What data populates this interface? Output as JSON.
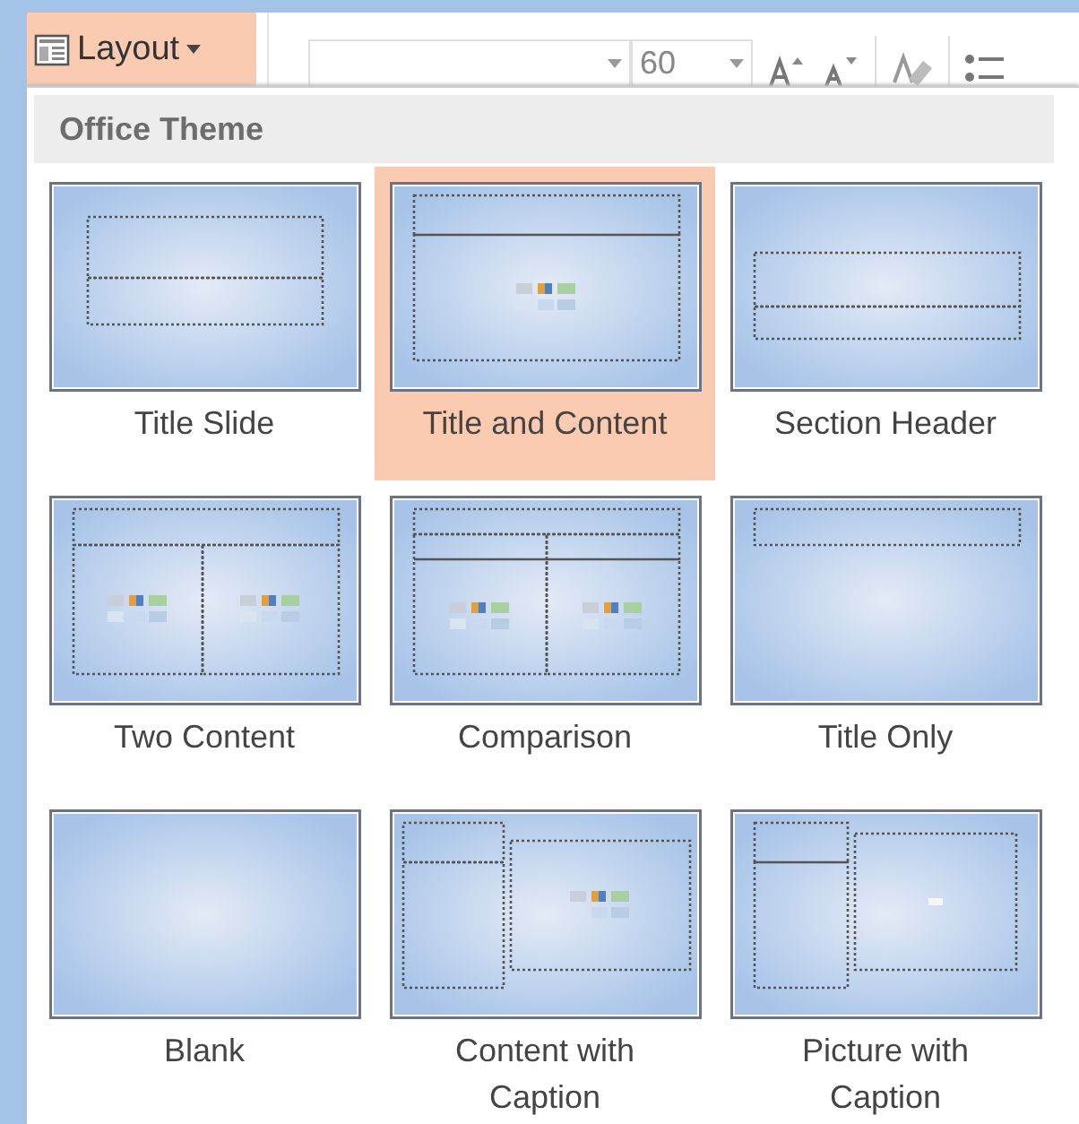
{
  "ribbon": {
    "layout_button": "Layout",
    "font_size": "60"
  },
  "menu": {
    "header": "Office Theme",
    "layouts": [
      {
        "label": "Title Slide",
        "kind": "title-slide",
        "selected": false
      },
      {
        "label": "Title and Content",
        "kind": "title-content",
        "selected": true
      },
      {
        "label": "Section Header",
        "kind": "section-header",
        "selected": false
      },
      {
        "label": "Two Content",
        "kind": "two-content",
        "selected": false
      },
      {
        "label": "Comparison",
        "kind": "comparison",
        "selected": false
      },
      {
        "label": "Title Only",
        "kind": "title-only",
        "selected": false
      },
      {
        "label": "Blank",
        "kind": "blank",
        "selected": false
      },
      {
        "label": "Content with\nCaption",
        "kind": "content-caption",
        "selected": false
      },
      {
        "label": "Picture with\nCaption",
        "kind": "picture-caption",
        "selected": false
      }
    ]
  }
}
